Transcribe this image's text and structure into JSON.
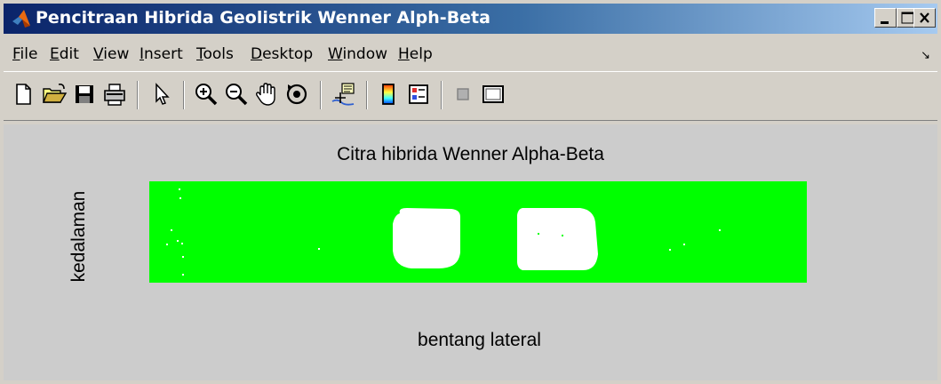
{
  "window": {
    "title": "Pencitraan Hibrida Geolistrik Wenner Alph-Beta",
    "title_gradient": [
      "#0a246a",
      "#a6caf0"
    ]
  },
  "menu": {
    "items": [
      {
        "label": "File",
        "mnemonic": "F",
        "rest": "ile"
      },
      {
        "label": "Edit",
        "mnemonic": "E",
        "rest": "dit"
      },
      {
        "label": "View",
        "mnemonic": "V",
        "rest": "iew"
      },
      {
        "label": "Insert",
        "mnemonic": "I",
        "rest": "nsert"
      },
      {
        "label": "Tools",
        "mnemonic": "T",
        "rest": "ools"
      },
      {
        "label": "Desktop",
        "mnemonic": "D",
        "rest": "esktop"
      },
      {
        "label": "Window",
        "mnemonic": "W",
        "rest": "indow"
      },
      {
        "label": "Help",
        "mnemonic": "H",
        "rest": "elp"
      }
    ],
    "overflow_icon": "dock-arrow-icon"
  },
  "toolbar": {
    "buttons": [
      "new-file-icon",
      "open-folder-icon",
      "save-icon",
      "print-icon",
      "pointer-icon",
      "zoom-in-icon",
      "zoom-out-icon",
      "pan-hand-icon",
      "rotate-3d-icon",
      "data-cursor-icon",
      "colorbar-icon",
      "legend-icon",
      "hide-plot-tools-icon",
      "show-plot-tools-icon"
    ]
  },
  "figure": {
    "title": "Citra hibrida Wenner Alpha-Beta",
    "xlabel": "bentang lateral",
    "ylabel": "kedalaman"
  },
  "colors": {
    "background": "#cccccc",
    "image_green": "#00ff00",
    "image_white": "#ffffff"
  },
  "chart_data": {
    "type": "heatmap",
    "title": "Citra hibrida Wenner Alpha-Beta",
    "xlabel": "bentang lateral",
    "ylabel": "kedalaman",
    "values": [
      "green background",
      "white blob 1",
      "white blob 2"
    ],
    "legend": "none",
    "grid": false
  }
}
